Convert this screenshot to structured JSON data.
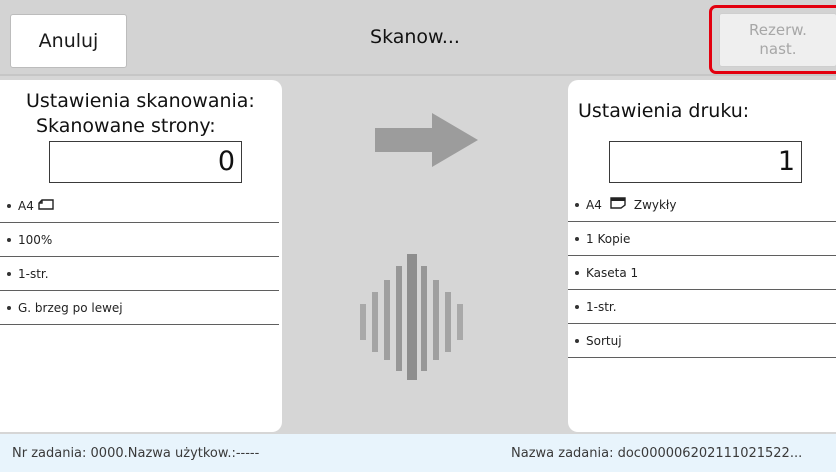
{
  "header": {
    "cancel_label": "Anuluj",
    "title": "Skanow...",
    "reserve_label_line1": "Rezerw.",
    "reserve_label_line2": "nast."
  },
  "scan_panel": {
    "title_line1": "Ustawienia skanowania:",
    "title_line2": "Skanowane strony:",
    "count": "0",
    "items": [
      {
        "label": "A4",
        "icon": "paper-landscape-icon"
      },
      {
        "label": "100%"
      },
      {
        "label": "1-str."
      },
      {
        "label": "G. brzeg po lewej"
      }
    ]
  },
  "print_panel": {
    "title": "Ustawienia druku:",
    "count": "1",
    "items": [
      {
        "label": "A4",
        "icon": "paper-portrait-icon",
        "suffix": "Zwykły"
      },
      {
        "label": "1 Kopie"
      },
      {
        "label": "Kaseta 1"
      },
      {
        "label": "1-str."
      },
      {
        "label": "Sortuj"
      }
    ]
  },
  "footer": {
    "left": "Nr zadania: 0000.Nazwa użytkow.:-----",
    "right": "Nazwa zadania: doc000006202111021522..."
  },
  "colors": {
    "highlight": "#e3000f",
    "arrow": "#9c9c9c",
    "work_area": "#d6d6d6",
    "page_bg": "#e8f4fc"
  }
}
